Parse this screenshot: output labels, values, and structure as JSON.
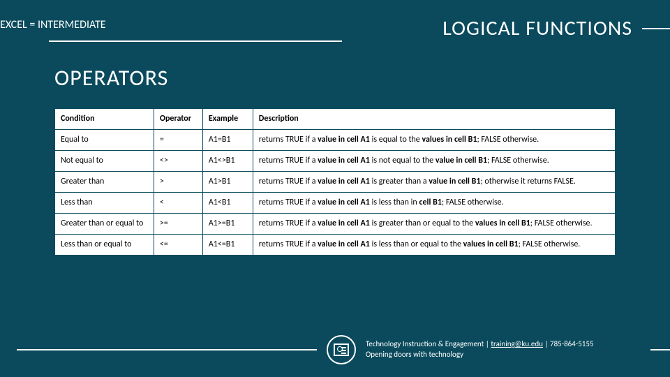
{
  "header": {
    "breadcrumb": "EXCEL  =  INTERMEDIATE",
    "title": "LOGICAL FUNCTIONS"
  },
  "section": {
    "title": "OPERATORS"
  },
  "table": {
    "headers": {
      "condition": "Condition",
      "operator": "Operator",
      "example": "Example",
      "description": "Description"
    },
    "rows": [
      {
        "condition": "Equal to",
        "operator": "=",
        "example": "A1=B1",
        "desc_pre": "returns TRUE if a ",
        "desc_b1": "value in cell A1",
        "desc_mid": " is equal to the ",
        "desc_b2": "values in cell B1",
        "desc_post": "; FALSE otherwise."
      },
      {
        "condition": "Not equal to",
        "operator": "<>",
        "example": "A1<>B1",
        "desc_pre": "returns TRUE if a ",
        "desc_b1": "value in cell A1",
        "desc_mid": " is not equal to the ",
        "desc_b2": "value in cell B1",
        "desc_post": "; FALSE otherwise."
      },
      {
        "condition": "Greater than",
        "operator": ">",
        "example": "A1>B1",
        "desc_pre": "returns TRUE if a ",
        "desc_b1": "value in cell A1",
        "desc_mid": " is greater than a ",
        "desc_b2": "value in cell B1",
        "desc_post": "; otherwise it returns FALSE."
      },
      {
        "condition": "Less than",
        "operator": "<",
        "example": "A1<B1",
        "desc_pre": "returns TRUE if a ",
        "desc_b1": "value in cell A1",
        "desc_mid": " is less than in ",
        "desc_b2": "cell B1",
        "desc_post": "; FALSE otherwise."
      },
      {
        "condition": "Greater than or equal to",
        "operator": ">=",
        "example": "A1>=B1",
        "desc_pre": "returns TRUE if a ",
        "desc_b1": "value in cell A1",
        "desc_mid": " is greater than or equal to the ",
        "desc_b2": "values in cell B1",
        "desc_post": "; FALSE otherwise."
      },
      {
        "condition": "Less than or equal to",
        "operator": "<=",
        "example": "A1<=B1",
        "desc_pre": "returns TRUE if a ",
        "desc_b1": "value in cell A1",
        "desc_mid": " is less than or equal to the ",
        "desc_b2": "values in cell B1",
        "desc_post": "; FALSE otherwise."
      }
    ]
  },
  "footer": {
    "line1_pre": "Technology Instruction & Engagement | ",
    "email": "training@ku.edu",
    "line1_post": " | 785-864-5155",
    "line2": "Opening doors with technology"
  }
}
